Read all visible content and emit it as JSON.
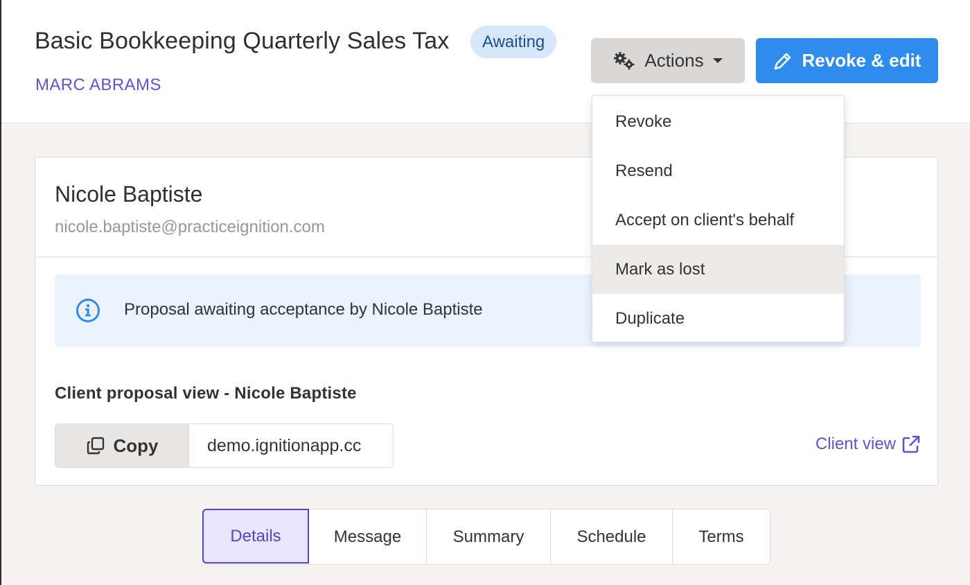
{
  "header": {
    "title": "Basic Bookkeeping Quarterly Sales Tax",
    "status": "Awaiting",
    "client": "MARC ABRAMS",
    "actions_label": "Actions",
    "revoke_edit_label": "Revoke & edit"
  },
  "actions_menu": {
    "items": [
      {
        "label": "Revoke"
      },
      {
        "label": "Resend"
      },
      {
        "label": "Accept on client's behalf"
      },
      {
        "label": "Mark as lost",
        "hovered": true
      },
      {
        "label": "Duplicate"
      }
    ]
  },
  "recipient": {
    "name": "Nicole Baptiste",
    "email": "nicole.baptiste@practiceignition.com"
  },
  "info_banner": {
    "icon": "info-circle-icon",
    "text": "Proposal awaiting acceptance by Nicole Baptiste"
  },
  "client_view": {
    "section_label": "Client proposal view - Nicole Baptiste",
    "copy_label": "Copy",
    "url_value": "demo.ignitionapp.cc",
    "link_label": "Client view"
  },
  "tabs": [
    {
      "label": "Details",
      "active": true
    },
    {
      "label": "Message"
    },
    {
      "label": "Summary"
    },
    {
      "label": "Schedule"
    },
    {
      "label": "Terms"
    }
  ],
  "colors": {
    "accent_purple": "#5b55d6",
    "primary_blue": "#2d8cec",
    "badge_bg": "#d6e6fb",
    "info_bg": "#e9f2fd"
  }
}
